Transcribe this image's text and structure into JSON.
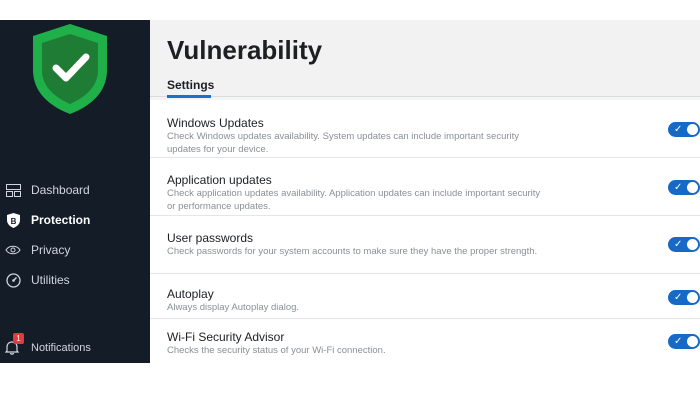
{
  "sidebar": {
    "nav": [
      {
        "label": "Dashboard",
        "icon": "dashboard-icon"
      },
      {
        "label": "Protection",
        "icon": "protection-icon",
        "active": true
      },
      {
        "label": "Privacy",
        "icon": "eye-icon"
      },
      {
        "label": "Utilities",
        "icon": "gauge-icon"
      }
    ],
    "notifications": {
      "label": "Notifications",
      "count": "1"
    }
  },
  "page": {
    "title": "Vulnerability",
    "tab": "Settings"
  },
  "settings": [
    {
      "title": "Windows Updates",
      "description": "Check Windows updates availability. System updates can include important security updates for your device.",
      "enabled": true
    },
    {
      "title": "Application updates",
      "description": "Check application updates availability. Application updates can include important security or performance updates.",
      "enabled": true
    },
    {
      "title": "User passwords",
      "description": "Check passwords for your system accounts to make sure they have the proper strength.",
      "enabled": true
    },
    {
      "title": "Autoplay",
      "description": "Always display Autoplay dialog.",
      "enabled": true
    },
    {
      "title": "Wi-Fi Security Advisor",
      "description": "Checks the security status of your Wi-Fi connection.",
      "enabled": true
    }
  ],
  "colors": {
    "sidebar_bg": "#141c27",
    "accent": "#1769c6",
    "shield": "#1fb04a"
  }
}
